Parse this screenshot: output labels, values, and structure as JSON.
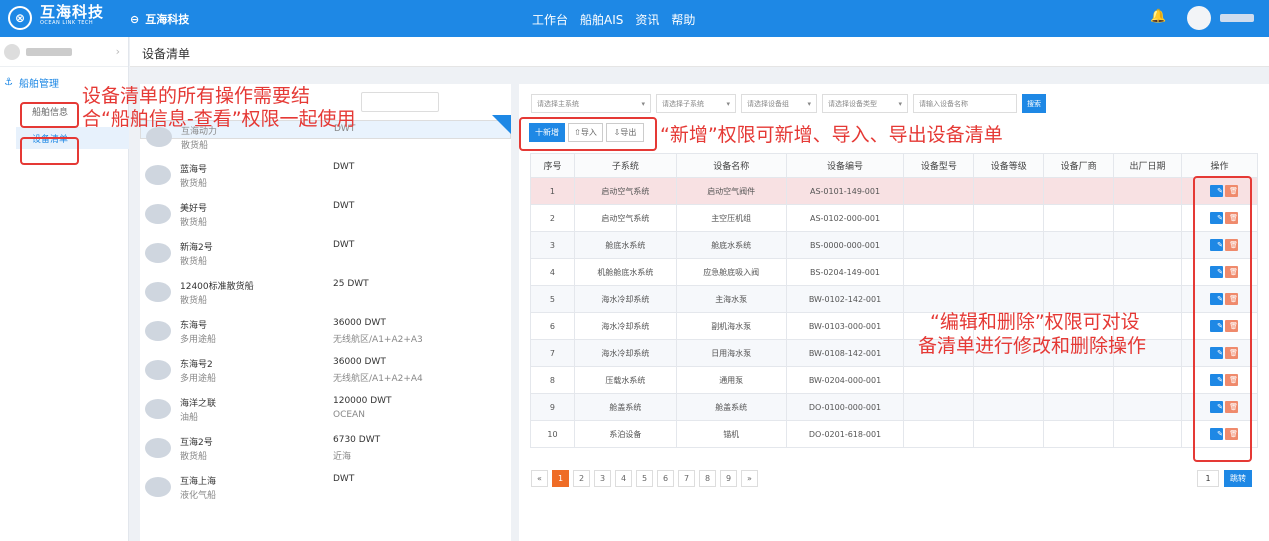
{
  "topbar": {
    "logo_mark": "⊗",
    "logo_cn": "互海科技",
    "logo_en": "OCEAN LINK TECH",
    "back_icon": "⊖",
    "org_name": "互海科技",
    "nav": [
      "工作台",
      "船舶AIS",
      "资讯",
      "帮助"
    ],
    "bell": "🔔"
  },
  "sidebar": {
    "arrow": "›",
    "group_icon": "⚓",
    "group_label": "船舶管理",
    "items": [
      "船舶信息",
      "设备清单"
    ]
  },
  "breadcrumb": "设备清单",
  "ships": [
    {
      "name": "互海动力",
      "type": "散货船",
      "dwt": "DWT",
      "extra": ""
    },
    {
      "name": "蓝海号",
      "type": "散货船",
      "dwt": "DWT",
      "extra": ""
    },
    {
      "name": "美好号",
      "type": "散货船",
      "dwt": "DWT",
      "extra": ""
    },
    {
      "name": "新海2号",
      "type": "散货船",
      "dwt": "DWT",
      "extra": ""
    },
    {
      "name": "12400标准散货船",
      "type": "散货船",
      "dwt": "25 DWT",
      "extra": ""
    },
    {
      "name": "东海号",
      "type": "多用途船",
      "dwt": "36000 DWT",
      "extra": "无线航区/A1+A2+A3"
    },
    {
      "name": "东海号2",
      "type": "多用途船",
      "dwt": "36000 DWT",
      "extra": "无线航区/A1+A2+A4"
    },
    {
      "name": "海洋之联",
      "type": "油船",
      "dwt": "120000 DWT",
      "extra": "OCEAN"
    },
    {
      "name": "互海2号",
      "type": "散货船",
      "dwt": "6730 DWT",
      "extra": "近海"
    },
    {
      "name": "互海上海",
      "type": "液化气船",
      "dwt": "DWT",
      "extra": ""
    }
  ],
  "filters": [
    {
      "label": "请选择主系统",
      "arrow": "▾"
    },
    {
      "label": "请选择子系统",
      "arrow": "▾"
    },
    {
      "label": "请选择设备组",
      "arrow": "▾"
    },
    {
      "label": "请选择设备类型",
      "arrow": "▾"
    },
    {
      "label": "请输入设备名称",
      "arrow": ""
    }
  ],
  "search_label": "搜索",
  "buttons": {
    "add": "十新增",
    "import": "⇧导入",
    "export": "⇩导出"
  },
  "table": {
    "headers": [
      "序号",
      "子系统",
      "设备名称",
      "设备编号",
      "设备型号",
      "设备等级",
      "设备厂商",
      "出厂日期",
      "操作"
    ],
    "rows": [
      [
        "1",
        "启动空气系统",
        "启动空气阀件",
        "AS-0101-149-001"
      ],
      [
        "2",
        "启动空气系统",
        "主空压机组",
        "AS-0102-000-001"
      ],
      [
        "3",
        "舱底水系统",
        "舱底水系统",
        "BS-0000-000-001"
      ],
      [
        "4",
        "机舱舱底水系统",
        "应急舱底吸入阀",
        "BS-0204-149-001"
      ],
      [
        "5",
        "海水冷却系统",
        "主海水泵",
        "BW-0102-142-001"
      ],
      [
        "6",
        "海水冷却系统",
        "副机海水泵",
        "BW-0103-000-001"
      ],
      [
        "7",
        "海水冷却系统",
        "日用海水泵",
        "BW-0108-142-001"
      ],
      [
        "8",
        "压载水系统",
        "通用泵",
        "BW-0204-000-001"
      ],
      [
        "9",
        "舱盖系统",
        "舱盖系统",
        "DO-0100-000-001"
      ],
      [
        "10",
        "系泊设备",
        "锚机",
        "DO-0201-618-001"
      ]
    ],
    "edit_icon": "✎",
    "delete_icon": "🗑"
  },
  "pager": {
    "prev": "«",
    "pages": [
      "1",
      "2",
      "3",
      "4",
      "5",
      "6",
      "7",
      "8",
      "9"
    ],
    "next": "»",
    "goto_value": "1",
    "goto_label": "跳转"
  },
  "notes": {
    "left_1": "设备清单的所有操作需要结",
    "left_2": "合“船舶信息-查看”权限一起使用",
    "middle": "“新增”权限可新增、导入、导出设备清单",
    "right_1": "“编辑和删除”权限可对设",
    "right_2": "备清单进行修改和删除操作"
  }
}
